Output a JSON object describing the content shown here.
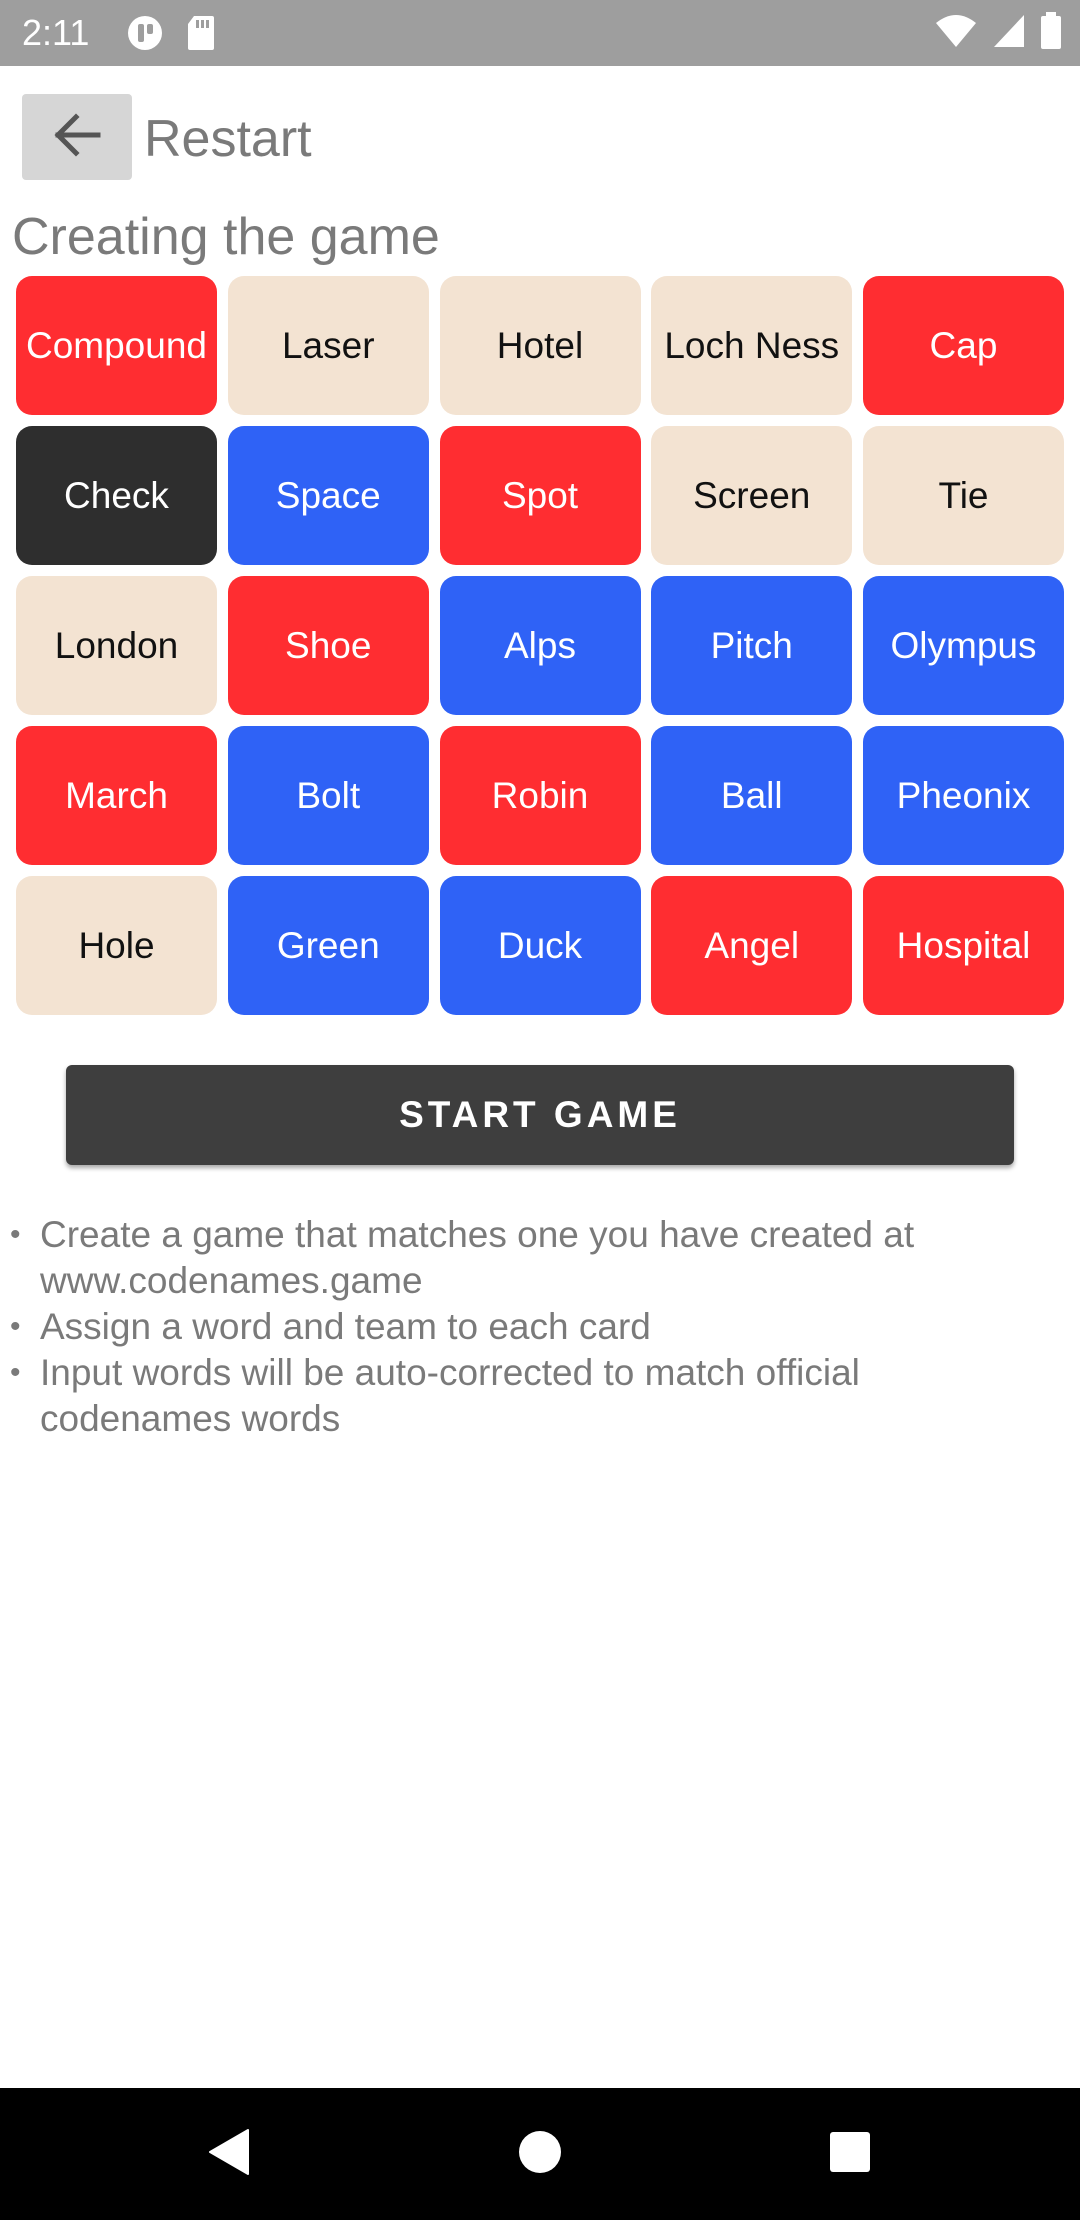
{
  "status_bar": {
    "time": "2:11",
    "left_icons": [
      "notification-app-icon",
      "sd-card-icon"
    ],
    "right_icons": [
      "wifi-icon",
      "cell-signal-icon",
      "battery-icon"
    ]
  },
  "header": {
    "back_icon": "arrow-left-icon",
    "restart_label": "Restart"
  },
  "page_title": "Creating the game",
  "colors": {
    "red": "#ff2d31",
    "blue": "#2f62f6",
    "neutral": "#f3e3d2",
    "assassin": "#2e2e2e"
  },
  "cards": [
    {
      "word": "Compound",
      "team": "red"
    },
    {
      "word": "Laser",
      "team": "neutral"
    },
    {
      "word": "Hotel",
      "team": "neutral"
    },
    {
      "word": "Loch Ness",
      "team": "neutral"
    },
    {
      "word": "Cap",
      "team": "red"
    },
    {
      "word": "Check",
      "team": "assassin"
    },
    {
      "word": "Space",
      "team": "blue"
    },
    {
      "word": "Spot",
      "team": "red"
    },
    {
      "word": "Screen",
      "team": "neutral"
    },
    {
      "word": "Tie",
      "team": "neutral"
    },
    {
      "word": "London",
      "team": "neutral"
    },
    {
      "word": "Shoe",
      "team": "red"
    },
    {
      "word": "Alps",
      "team": "blue"
    },
    {
      "word": "Pitch",
      "team": "blue"
    },
    {
      "word": "Olympus",
      "team": "blue"
    },
    {
      "word": "March",
      "team": "red"
    },
    {
      "word": "Bolt",
      "team": "blue"
    },
    {
      "word": "Robin",
      "team": "red"
    },
    {
      "word": "Ball",
      "team": "blue"
    },
    {
      "word": "Pheonix",
      "team": "blue"
    },
    {
      "word": "Hole",
      "team": "neutral"
    },
    {
      "word": "Green",
      "team": "blue"
    },
    {
      "word": "Duck",
      "team": "blue"
    },
    {
      "word": "Angel",
      "team": "red"
    },
    {
      "word": "Hospital",
      "team": "red"
    }
  ],
  "start_button_label": "START GAME",
  "instructions": [
    "Create a game that matches one you have created at www.codenames.game",
    "Assign a word and team to each card",
    "Input words will be auto-corrected to match official codenames words"
  ],
  "nav_bar": {
    "icons": [
      "back-triangle-icon",
      "home-circle-icon",
      "recents-square-icon"
    ]
  }
}
